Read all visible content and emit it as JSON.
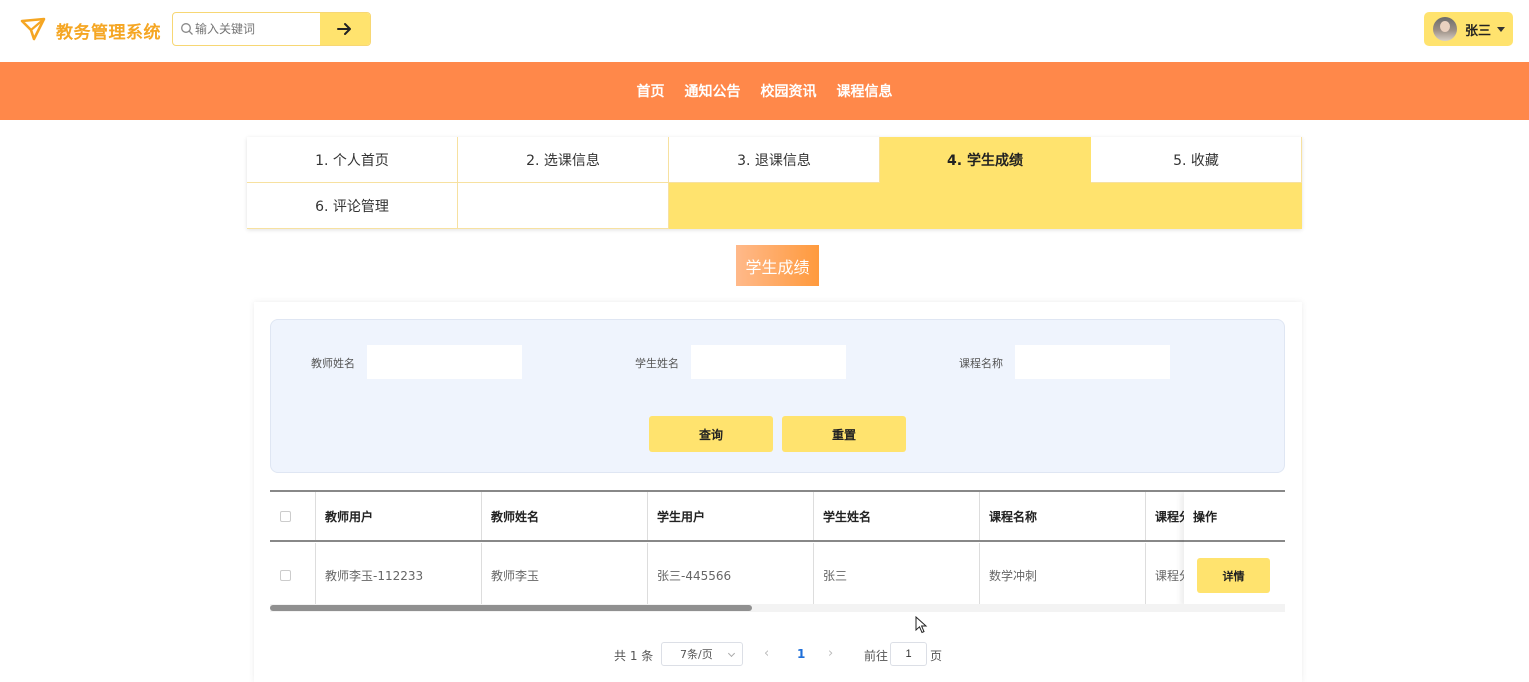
{
  "header": {
    "brand": "教务管理系统",
    "search_placeholder": "输入关键词",
    "user_name": "张三"
  },
  "nav": [
    "首页",
    "通知公告",
    "校园资讯",
    "课程信息"
  ],
  "tabs": [
    "1. 个人首页",
    "2. 选课信息",
    "3. 退课信息",
    "4. 学生成绩",
    "5. 收藏",
    "6. 评论管理"
  ],
  "active_tab": "4. 学生成绩",
  "section_title": "学生成绩",
  "filters": {
    "teacher_name_label": "教师姓名",
    "student_name_label": "学生姓名",
    "course_name_label": "课程名称",
    "teacher_name_value": "",
    "student_name_value": "",
    "course_name_value": "",
    "query_button": "查询",
    "reset_button": "重置"
  },
  "table": {
    "columns": [
      "教师用户",
      "教师姓名",
      "学生用户",
      "学生姓名",
      "课程名称",
      "课程分"
    ],
    "op_header": "操作",
    "rows": [
      {
        "cells": [
          "教师李玉-112233",
          "教师李玉",
          "张三-445566",
          "张三",
          "数学冲刺",
          "课程分"
        ],
        "action": "详情"
      }
    ]
  },
  "pagination": {
    "total": "共 1 条",
    "page_size": "7条/页",
    "current_page": "1",
    "goto_label": "前往",
    "goto_value": "1",
    "page_suffix": "页"
  },
  "colors": {
    "accent_orange": "#ff884a",
    "accent_yellow": "#ffe36e",
    "brand": "#f5a623",
    "link_blue": "#1e6fd9"
  }
}
